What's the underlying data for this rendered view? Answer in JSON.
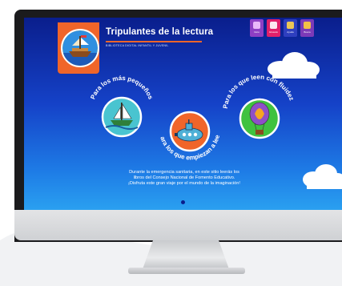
{
  "site": {
    "title": "Tripulantes de la lectura",
    "subtitle": "BIBLIOTECA DIGITAL INFANTIL Y JUVENIL"
  },
  "nav": {
    "items": [
      {
        "label": "Inicio",
        "color": "#8e3fc4",
        "icon": "home-icon"
      },
      {
        "label": "Glosario",
        "color": "#e0206a",
        "icon": "book-icon"
      },
      {
        "label": "Ayuda",
        "color": "#2e3fbf",
        "icon": "help-icon"
      },
      {
        "label": "Busca",
        "color": "#7b3ab8",
        "icon": "search-icon"
      }
    ]
  },
  "categories": [
    {
      "label": "Para los más pequeños",
      "color": "#49c4d0",
      "icon": "sailboat-icon"
    },
    {
      "label": "Para los que empiezan a leer",
      "color": "#f0652a",
      "icon": "submarine-icon"
    },
    {
      "label": "Para los que leen con fluidez",
      "color": "#3fc23f",
      "icon": "hot-air-balloon-icon"
    }
  ],
  "intro_text": "Durante la emergencia sanitaria, en este sitio leerás los libros del Consejo Nacional de Fomento Educativo. ¡Disfruta este gran viaje por el mundo de la imaginación!",
  "colors": {
    "accent": "#f0652a",
    "sky_top": "#0a1e8c",
    "sky_bottom": "#2aa0f0"
  }
}
